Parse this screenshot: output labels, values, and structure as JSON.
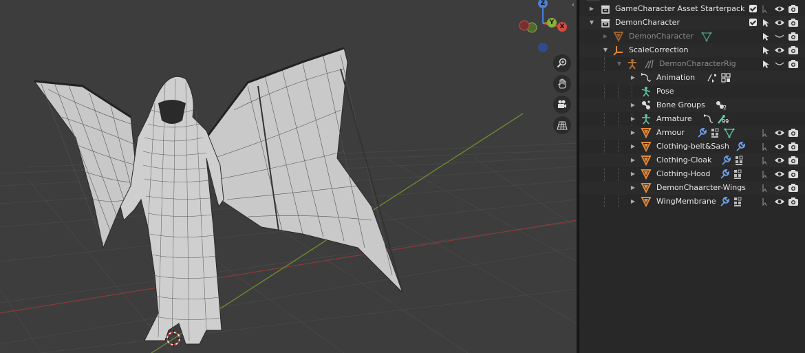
{
  "gizmo": {
    "z_label": "Z",
    "y_label": "Y",
    "x_label": "X"
  },
  "viewport": {
    "nav_buttons": [
      {
        "name": "zoom-icon"
      },
      {
        "name": "hand-pan-icon"
      },
      {
        "name": "camera-icon"
      },
      {
        "name": "grid-perspective-icon"
      }
    ]
  },
  "outliner": {
    "rows": [
      {
        "label": "GameCharacter Asset Starterpack",
        "type": "collection",
        "icon": "collection-icon"
      },
      {
        "label": "DemonCharacter",
        "type": "collection",
        "icon": "collection-icon"
      },
      {
        "label": "DemonCharacter",
        "type": "mesh",
        "icon": "mesh-icon",
        "dim": true
      },
      {
        "label": "ScaleCorrection",
        "type": "empty",
        "icon": "empty-axes-icon"
      },
      {
        "label": "DemonCharacterRig",
        "type": "armature",
        "icon": "armature-icon",
        "dim": true
      },
      {
        "label": "Animation",
        "type": "data",
        "icon": "animation-icon"
      },
      {
        "label": "Pose",
        "type": "data",
        "icon": "pose-icon"
      },
      {
        "label": "Bone Groups",
        "type": "data",
        "icon": "bone-groups-icon",
        "count": "2"
      },
      {
        "label": "Armature",
        "type": "data",
        "icon": "armature-data-icon",
        "count": "99"
      },
      {
        "label": "Armour",
        "type": "mesh",
        "icon": "mesh-icon"
      },
      {
        "label": "Clothing-belt&Sash",
        "type": "mesh",
        "icon": "mesh-icon"
      },
      {
        "label": "Clothing-Cloak",
        "type": "mesh",
        "icon": "mesh-icon"
      },
      {
        "label": "Clothing-Hood",
        "type": "mesh",
        "icon": "mesh-icon"
      },
      {
        "label": "DemonChaarcter-Wings",
        "type": "mesh",
        "icon": "mesh-icon"
      },
      {
        "label": "WingMembrane",
        "type": "mesh",
        "icon": "mesh-icon"
      }
    ]
  },
  "colors": {
    "mesh": "#e08a3a",
    "armature": "#e08a3a",
    "data": "#5fc9a8",
    "modifier": "#6f9ee8",
    "selection_bg": "#334d80"
  }
}
